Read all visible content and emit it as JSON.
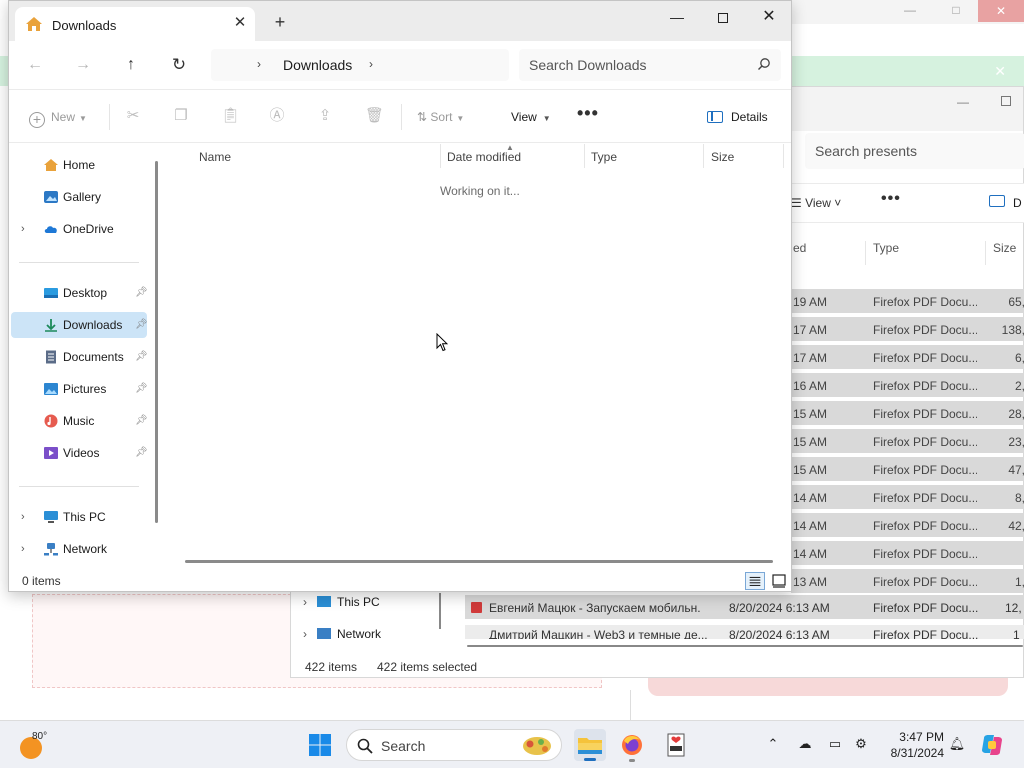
{
  "explorer": {
    "tab_title": "Downloads",
    "address_crumb": "Downloads",
    "search_placeholder": "Search Downloads",
    "commands": {
      "new": "New",
      "sort": "Sort",
      "view": "View",
      "more": "•••",
      "details": "Details"
    },
    "nav": {
      "home": "Home",
      "gallery": "Gallery",
      "onedrive": "OneDrive",
      "desktop": "Desktop",
      "downloads": "Downloads",
      "documents": "Documents",
      "pictures": "Pictures",
      "music": "Music",
      "videos": "Videos",
      "this_pc": "This PC",
      "network": "Network"
    },
    "columns": {
      "name": "Name",
      "date_modified": "Date modified",
      "type": "Type",
      "size": "Size"
    },
    "loading_text": "Working on it...",
    "status_items": "0 items"
  },
  "background_explorer": {
    "search_placeholder": "Search presents",
    "view": "View",
    "more": "•••",
    "details_partial": "D",
    "col_date_partial": "ed",
    "col_type": "Type",
    "col_size": "Size",
    "rows": [
      {
        "date": "19 AM",
        "type": "Firefox PDF Docu...",
        "size": "65,"
      },
      {
        "date": "17 AM",
        "type": "Firefox PDF Docu...",
        "size": "138,"
      },
      {
        "date": "17 AM",
        "type": "Firefox PDF Docu...",
        "size": "6,"
      },
      {
        "date": "16 AM",
        "type": "Firefox PDF Docu...",
        "size": "2,"
      },
      {
        "date": "15 AM",
        "type": "Firefox PDF Docu...",
        "size": "28,"
      },
      {
        "date": "15 AM",
        "type": "Firefox PDF Docu...",
        "size": "23,"
      },
      {
        "date": "15 AM",
        "type": "Firefox PDF Docu...",
        "size": "47,"
      },
      {
        "date": "14 AM",
        "type": "Firefox PDF Docu...",
        "size": "8,"
      },
      {
        "date": "14 AM",
        "type": "Firefox PDF Docu...",
        "size": "42,"
      },
      {
        "date": "14 AM",
        "type": "Firefox PDF Docu...",
        "size": ""
      },
      {
        "date": "13 AM",
        "type": "Firefox PDF Docu...",
        "size": "1,"
      }
    ],
    "row_full": {
      "name": "Евгений Мацюк - Запускаем мобильн...",
      "date": "8/20/2024 6:13 AM",
      "type": "Firefox PDF Docu...",
      "size": "12,"
    },
    "row_partial": {
      "name": "Дмитрий Мацкин - Web3 и темные де...",
      "date": "8/20/2024 6:13 AM",
      "type": "Firefox PDF Docu...",
      "size": "1"
    },
    "nav_this_pc": "This PC",
    "nav_network": "Network",
    "status_items": "422 items",
    "status_selected": "422 items selected"
  },
  "taskbar": {
    "temperature": "80°",
    "search_placeholder": "Search",
    "time": "3:47 PM",
    "date": "8/31/2024"
  },
  "colors": {
    "accent": "#1f6fbf",
    "nav_selected": "#cce4f7",
    "folder_yellow": "#f5c33b"
  }
}
